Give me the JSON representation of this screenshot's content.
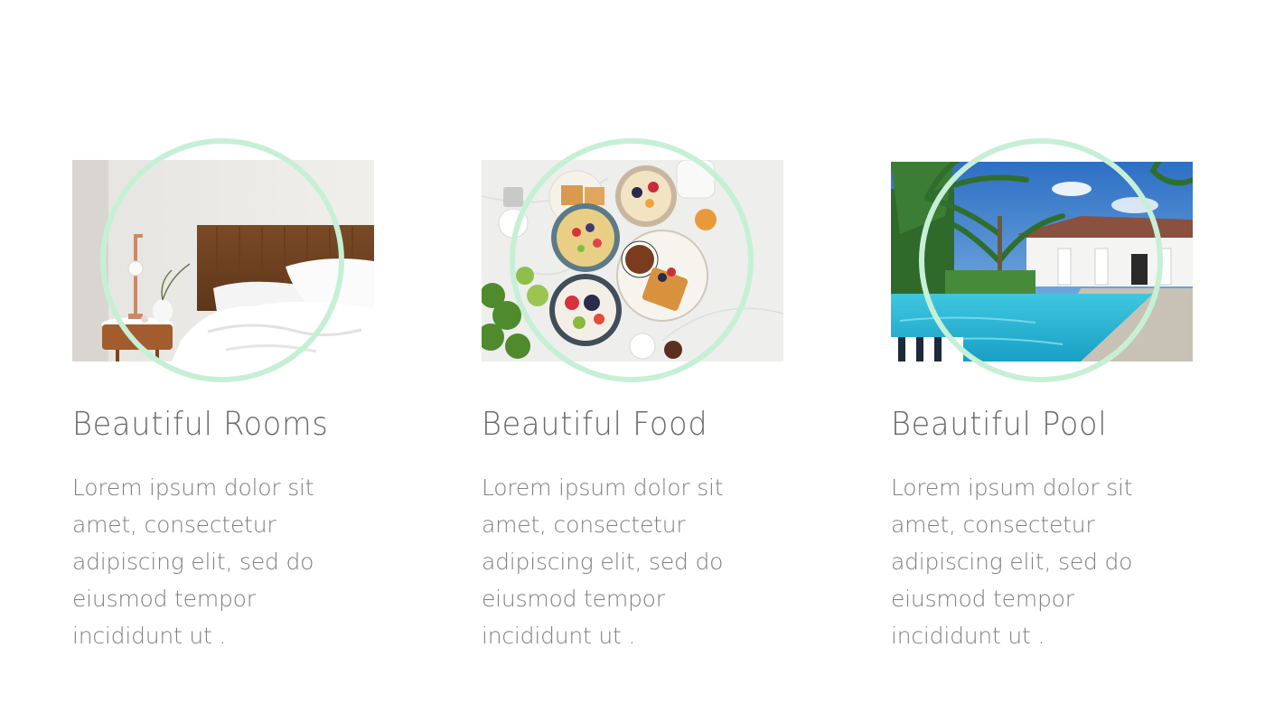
{
  "features": [
    {
      "title": "Beautiful Rooms",
      "image": "bedroom-photo",
      "description_lines": [
        "Lorem ipsum dolor sit",
        "amet, consectetur",
        "adipiscing elit, sed do",
        "eiusmod tempor",
        "incididunt ut ."
      ]
    },
    {
      "title": "Beautiful Food",
      "image": "breakfast-food-photo",
      "description_lines": [
        "Lorem ipsum dolor sit",
        "amet, consectetur",
        "adipiscing elit, sed do",
        "eiusmod tempor",
        "incididunt ut ."
      ]
    },
    {
      "title": "Beautiful Pool",
      "image": "swimming-pool-photo",
      "description_lines": [
        "Lorem ipsum dolor sit",
        "amet, consectetur",
        "adipiscing elit, sed do",
        "eiusmod tempor",
        "incididunt ut ."
      ]
    }
  ],
  "colors": {
    "ring": "#c6f0d6",
    "title": "#6a6a6a",
    "body": "#808080",
    "background": "#ffffff"
  }
}
